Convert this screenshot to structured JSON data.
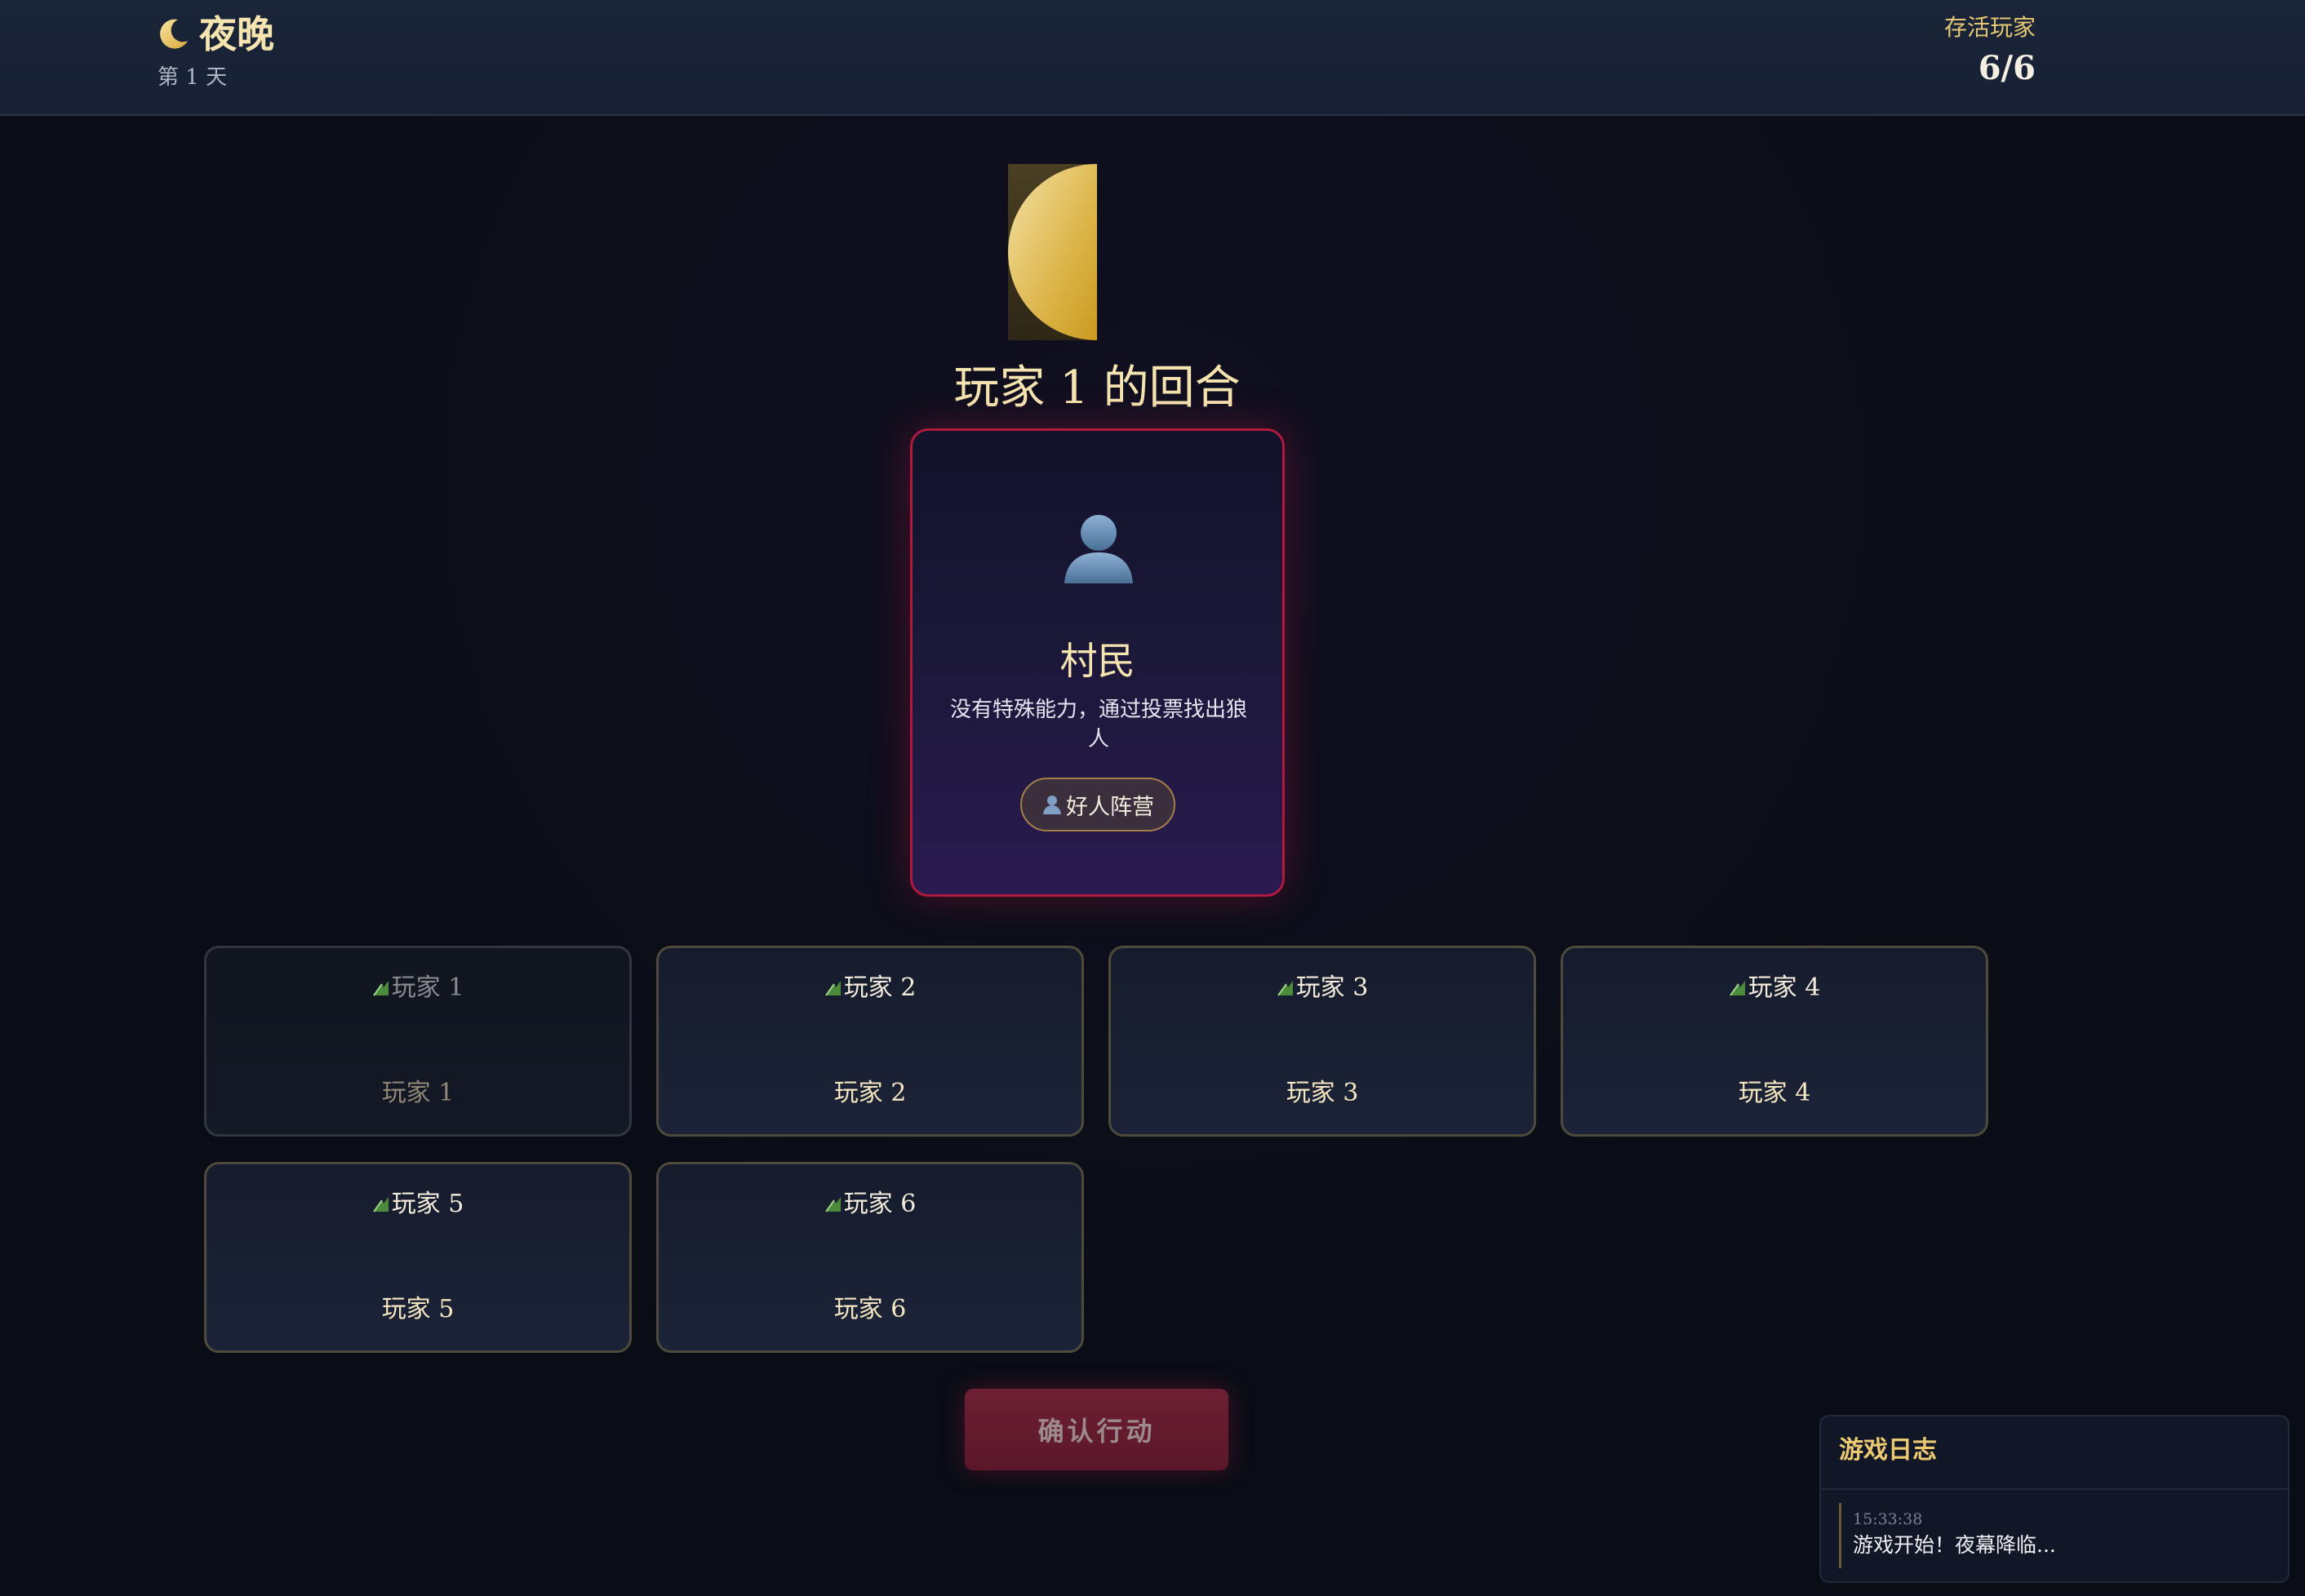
{
  "header": {
    "phase_title": "夜晚",
    "day_label": "第 1 天",
    "alive_label": "存活玩家",
    "alive_count": "6/6"
  },
  "turn": {
    "title": "玩家 1 的回合"
  },
  "role_card": {
    "icon": "person-silhouette-icon",
    "role_name": "村民",
    "description": "没有特殊能力，通过投票找出狼人",
    "camp_label": "好人阵营"
  },
  "players": [
    {
      "avatar_alt": "玩家 1",
      "name": "玩家 1",
      "is_self": true
    },
    {
      "avatar_alt": "玩家 2",
      "name": "玩家 2",
      "is_self": false
    },
    {
      "avatar_alt": "玩家 3",
      "name": "玩家 3",
      "is_self": false
    },
    {
      "avatar_alt": "玩家 4",
      "name": "玩家 4",
      "is_self": false
    },
    {
      "avatar_alt": "玩家 5",
      "name": "玩家 5",
      "is_self": false
    },
    {
      "avatar_alt": "玩家 6",
      "name": "玩家 6",
      "is_self": false
    }
  ],
  "actions": {
    "confirm_label": "确认行动"
  },
  "log": {
    "title": "游戏日志",
    "entries": [
      {
        "time": "15:33:38",
        "message": "游戏开始！夜幕降临..."
      }
    ]
  },
  "colors": {
    "accent_gold": "#f5e4b0",
    "danger_red": "#b01a3e",
    "background": "#0a0d16"
  }
}
